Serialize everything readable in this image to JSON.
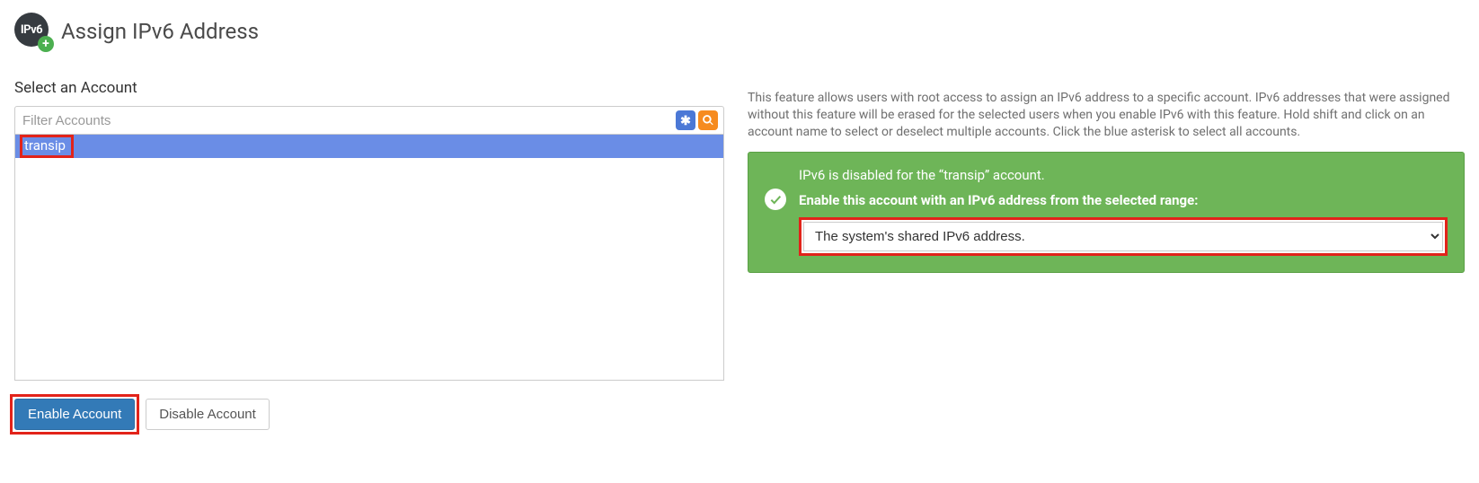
{
  "header": {
    "icon_label": "IPv6",
    "title": "Assign IPv6 Address"
  },
  "left": {
    "section_label": "Select an Account",
    "filter_placeholder": "Filter Accounts",
    "accounts": [
      "transip"
    ],
    "enable_button": "Enable Account",
    "disable_button": "Disable Account"
  },
  "right": {
    "help_text": "This feature allows users with root access to assign an IPv6 address to a specific account. IPv6 addresses that were assigned without this feature will be erased for the selected users when you enable IPv6 with this feature. Hold shift and click on an account name to select or deselect multiple accounts. Click the blue asterisk to select all accounts.",
    "panel": {
      "status_text": "IPv6 is disabled for the “transip” account.",
      "prompt_text": "Enable this account with an IPv6 address from the selected range:",
      "select_value": "The system's shared IPv6 address."
    }
  }
}
